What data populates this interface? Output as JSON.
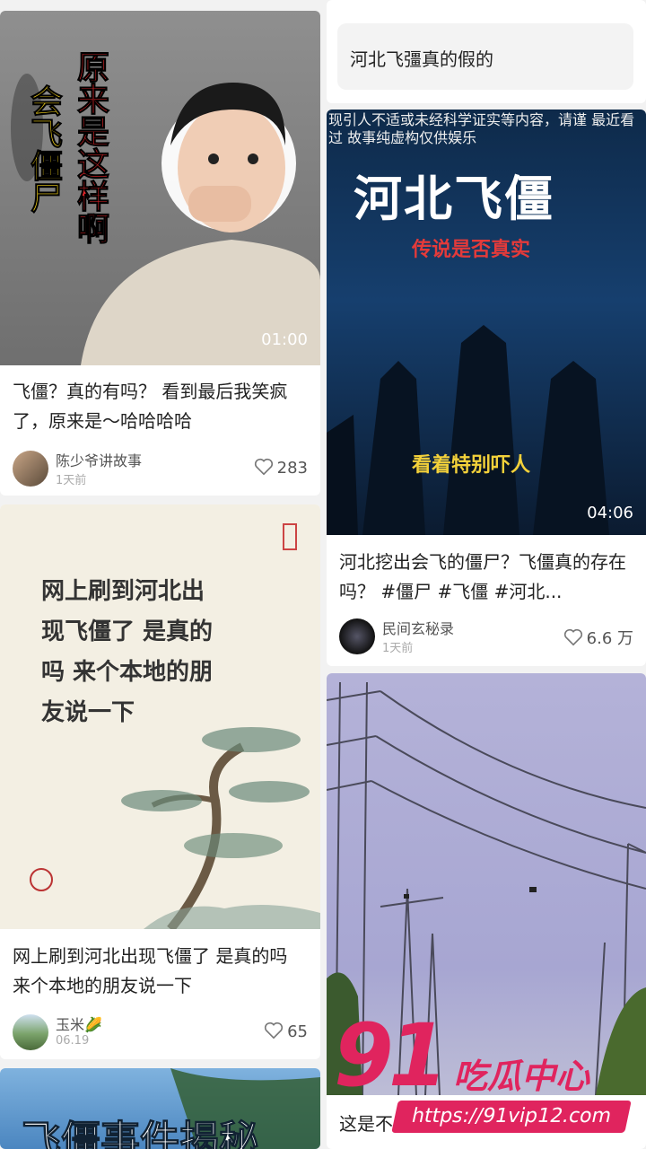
{
  "query_box": {
    "text": "河北飞彊真的假的"
  },
  "posts": [
    {
      "id": "post-1",
      "overlay_lines": [
        "原来是这样啊",
        "会飞僵尸"
      ],
      "duration": "01:00",
      "title": "飞僵？真的有吗？ 看到最后我笑疯了，原来是～哈哈哈哈",
      "author": "陈少爷讲故事",
      "date": "1天前",
      "likes": "283"
    },
    {
      "id": "post-2",
      "overlay_top": "现引人不适或未经科学证实等内容，请谨 最近看过 故事纯虚构仅供娱乐",
      "overlay_main": "河北飞僵",
      "overlay_sub": "传说是否真实",
      "overlay_bottom": "看着特别吓人",
      "duration": "04:06",
      "title": "河北挖出会飞的僵尸？飞僵真的存在吗？ #僵尸 #飞僵 #河北...",
      "author": "民间玄秘录",
      "date": "1天前",
      "likes": "6.6 万"
    },
    {
      "id": "post-3",
      "poem_lines": [
        "网上刷到河北出",
        "现飞僵了 是真的",
        "吗 来个本地的朋",
        "友说一下"
      ],
      "title": "网上刷到河北出现飞僵了 是真的吗 来个本地的朋友说一下",
      "author": "玉米🌽",
      "date": "06.19",
      "likes": "65"
    },
    {
      "id": "post-4",
      "title": "这是不是就是传说中的"
    },
    {
      "id": "post-5",
      "overlay_main": "飞僵事件揭秘"
    }
  ],
  "watermark": {
    "brand_number": "91",
    "brand_text": "吃瓜中心",
    "url": "https://91vip12.com"
  },
  "colors": {
    "accent": "#e0245e",
    "card_bg": "#ffffff",
    "page_bg": "#f2f2f2"
  }
}
